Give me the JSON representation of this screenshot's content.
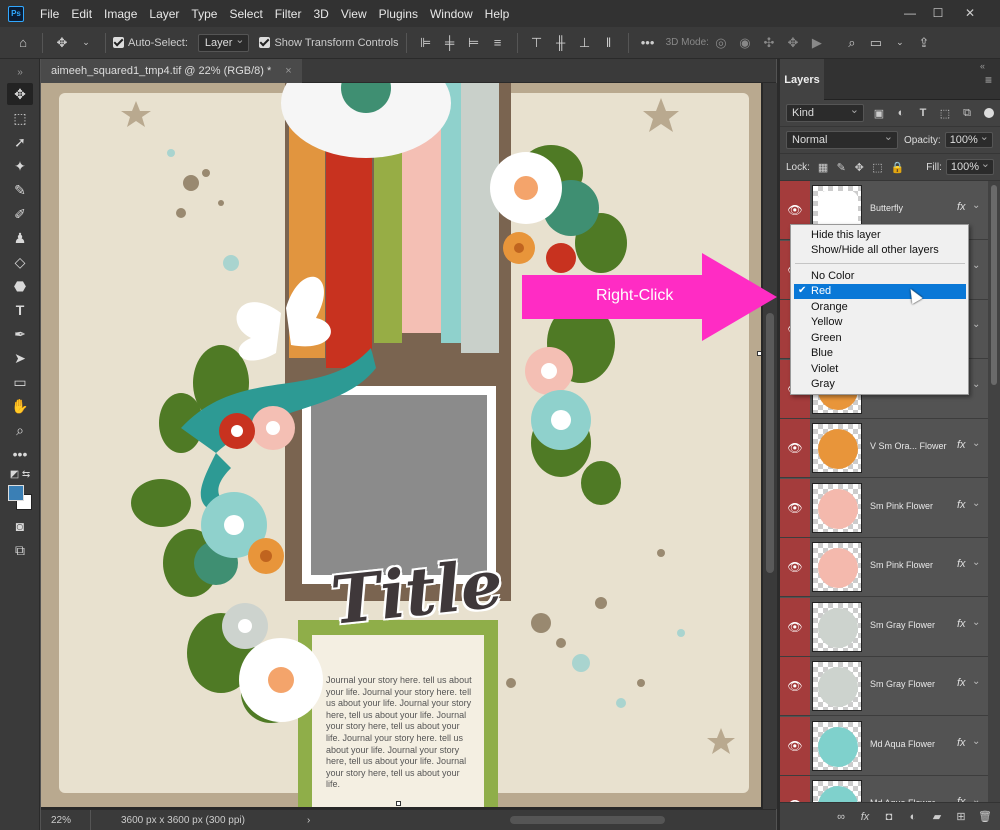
{
  "app": {
    "logo": "Ps"
  },
  "menu": [
    "File",
    "Edit",
    "Image",
    "Layer",
    "Type",
    "Select",
    "Filter",
    "3D",
    "View",
    "Plugins",
    "Window",
    "Help"
  ],
  "window_controls": {
    "minimize": "—",
    "maximize": "☐",
    "close": "✕"
  },
  "options": {
    "auto_select_label": "Auto-Select:",
    "auto_select_value": "Layer",
    "show_transform_label": "Show Transform Controls",
    "mode_3d_label": "3D Mode:",
    "more": "•••"
  },
  "document": {
    "tab_title": "aimeeh_squared1_tmp4.tif @ 22% (RGB/8) *",
    "tab_close": "×",
    "zoom": "22%",
    "info": "3600 px x 3600 px (300 ppi)",
    "nav": "›"
  },
  "canvas": {
    "title_art": "Title",
    "journal_text": "Journal your story here. tell us about your life. Journal your story here. tell us about your life. Journal your story here, tell us about your life. Journal your story here, tell us about your life. Journal your story here. tell us about your life. Journal your story here, tell us about your life. Journal your story here, tell us about your life."
  },
  "callout": {
    "text": "Right-Click",
    "color": "#ff2cc4"
  },
  "layers_panel": {
    "tab": "Layers",
    "menu_icon": "≡",
    "filter_kind": "Kind",
    "blend_mode": "Normal",
    "opacity_label": "Opacity:",
    "opacity_value": "100%",
    "lock_label": "Lock:",
    "fill_label": "Fill:",
    "fill_value": "100%",
    "layers": [
      {
        "name": "Butterfly",
        "fx": "fx",
        "thumb_color": "#ffffff"
      },
      {
        "name": "",
        "fx": "fx",
        "thumb_color": "#e0e0e0"
      },
      {
        "name": "",
        "fx": "fx",
        "thumb_color": "#e0e0e0"
      },
      {
        "name": "",
        "fx": "fx",
        "thumb_color": "#e8953a"
      },
      {
        "name": "V Sm Ora... Flower",
        "fx": "fx",
        "thumb_color": "#e8953a"
      },
      {
        "name": "Sm Pink Flower",
        "fx": "fx",
        "thumb_color": "#f4b9ad"
      },
      {
        "name": "Sm Pink Flower",
        "fx": "fx",
        "thumb_color": "#f4b9ad"
      },
      {
        "name": "Sm Gray Flower",
        "fx": "fx",
        "thumb_color": "#cdd3ce"
      },
      {
        "name": "Sm Gray Flower",
        "fx": "fx",
        "thumb_color": "#cdd3ce"
      },
      {
        "name": "Md Aqua Flower",
        "fx": "fx",
        "thumb_color": "#7fd1cc"
      },
      {
        "name": "Md Aqua Flower",
        "fx": "fx",
        "thumb_color": "#7fd1cc"
      }
    ],
    "visibility_color": "#a43c3c"
  },
  "context_menu": {
    "items_top": [
      "Hide this layer",
      "Show/Hide all other layers"
    ],
    "colors": [
      "No Color",
      "Red",
      "Orange",
      "Yellow",
      "Green",
      "Blue",
      "Violet",
      "Gray"
    ],
    "selected": "Red",
    "check": "✔"
  }
}
